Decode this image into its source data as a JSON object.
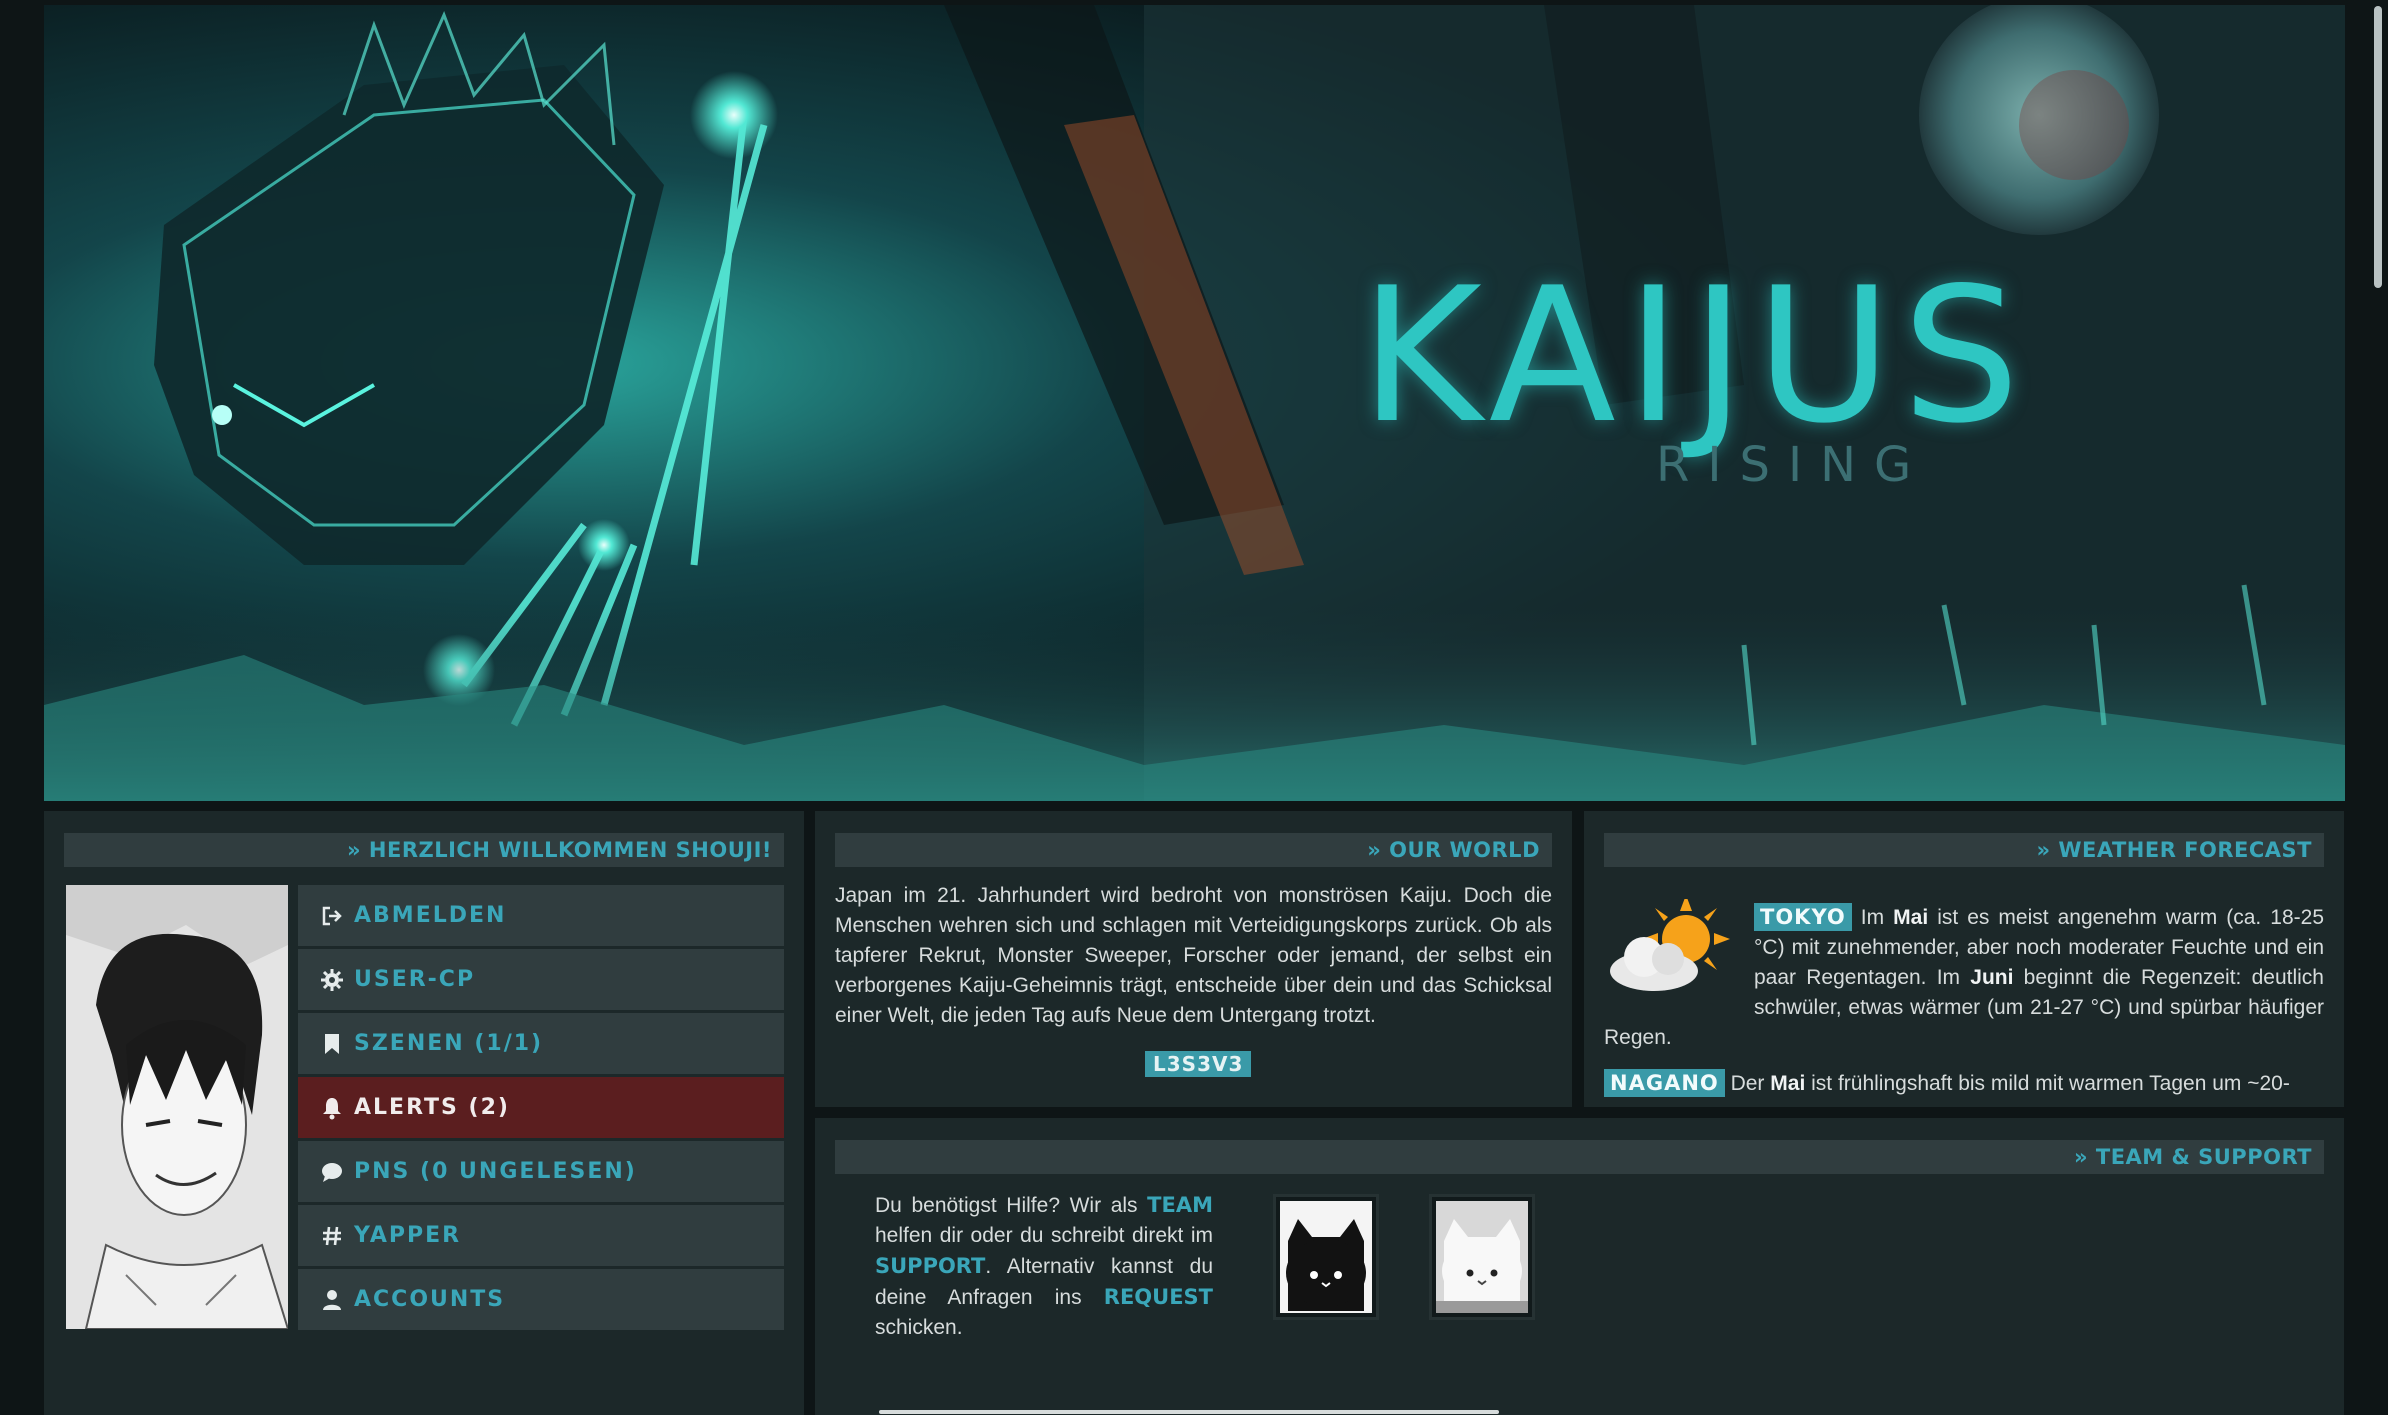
{
  "banner": {
    "title": "KAIJUS",
    "subtitle": "RISING"
  },
  "welcome": {
    "header": "» HERZLICH WILLKOMMEN SHOUJI!",
    "menu": [
      {
        "label": "ABMELDEN",
        "icon": "logout-icon"
      },
      {
        "label": "USER-CP",
        "icon": "gear-icon"
      },
      {
        "label": "SZENEN (1/1)",
        "icon": "bookmark-icon"
      },
      {
        "label": "ALERTS (2)",
        "icon": "bell-icon",
        "active": true
      },
      {
        "label": "PNS (0 UNGELESEN)",
        "icon": "chat-bubble-icon"
      },
      {
        "label": "YAPPER",
        "icon": "hashtag-icon"
      },
      {
        "label": "ACCOUNTS",
        "icon": "user-icon"
      }
    ]
  },
  "world": {
    "header": "» OUR WORLD",
    "text": "Japan im 21. Jahrhundert wird bedroht von monströsen Kaiju. Doch die Menschen wehren sich und schlagen mit Verteidigungskorps zurück. Ob als tapferer Rekrut, Monster Sweeper, Forscher oder jemand, der selbst ein verborgenes Kaiju-Geheimnis trägt, entscheide über dein und das Schicksal einer Welt, die jeden Tag aufs Neue dem Untergang trotzt.",
    "badge": "L3S3V3"
  },
  "weather": {
    "header": "» WEATHER FORECAST",
    "tokyo": {
      "city": "TOKYO",
      "p1": " Im ",
      "m1": "Mai",
      "p2": " ist es meist angenehm warm (ca. 18-25 °C) mit zunehmender, aber noch moderater Feuchte und ein paar Regentagen. Im ",
      "m2": "Juni",
      "p3": " beginnt die Regenzeit: deutlich schwüler, etwas wärmer (um 21-27 °C) und spürbar häufiger Regen."
    },
    "nagano": {
      "city": "NAGANO",
      "p1": " Der ",
      "m1": "Mai",
      "p2": " ist frühlingshaft bis mild mit warmen Tagen um ~20-"
    }
  },
  "team": {
    "header": "» TEAM & SUPPORT",
    "t1": "Du benötigst Hilfe? Wir als ",
    "link_team": "TEAM",
    "t2": " helfen dir oder du schreibt direkt im ",
    "link_support": "SUPPORT",
    "t3": ". Alternativ kannst du deine Anfragen ins ",
    "link_request": "REQUEST",
    "t4": " schicken."
  },
  "colors": {
    "accent": "#3aa6b9",
    "panel": "#1c2829",
    "header_bar": "#303d3f",
    "alert_active": "#5b1e1f"
  }
}
